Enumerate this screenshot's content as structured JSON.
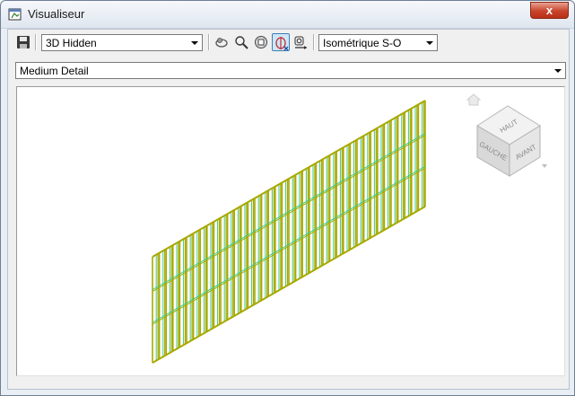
{
  "window": {
    "title": "Visualiseur",
    "close_label": "x"
  },
  "toolbar": {
    "visual_style": "3D Hidden",
    "view_preset": "Isométrique S-O",
    "buttons": [
      {
        "name": "save-icon"
      },
      {
        "name": "orbit-icon"
      },
      {
        "name": "zoom-icon"
      },
      {
        "name": "zoom-extents-icon"
      },
      {
        "name": "orbit-active-icon",
        "active": true
      },
      {
        "name": "camera-icon"
      }
    ]
  },
  "detail_level": "Medium Detail",
  "viewcube": {
    "top": "HAUT",
    "left": "GAUCHE",
    "front": "AVANT"
  },
  "colors": {
    "frame": "#a8a800",
    "inner": "#40c880"
  }
}
